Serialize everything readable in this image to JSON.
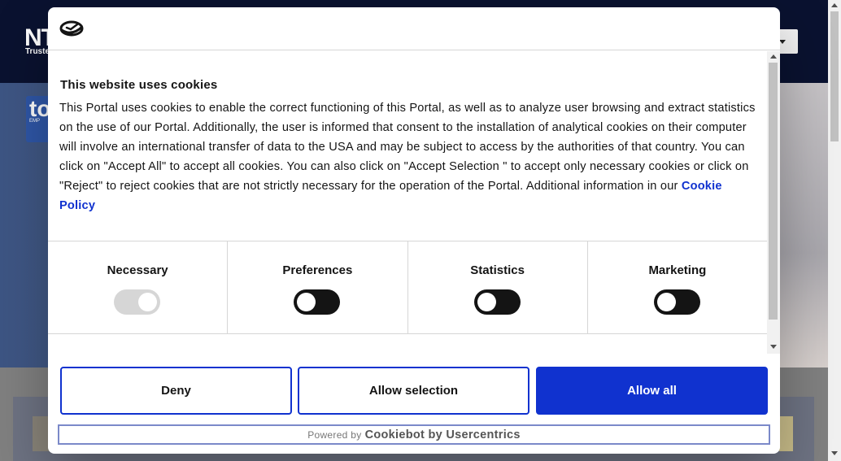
{
  "background": {
    "logo": "NT",
    "logo_sub": "Truste",
    "badge": "to",
    "badge_sub": "EMP"
  },
  "dialog": {
    "title": "This website uses cookies",
    "body_text": "This Portal uses cookies to enable the correct functioning of this Portal, as well as to analyze user browsing and extract statistics on the use of our Portal. Additionally, the user is informed that consent to the installation of analytical cookies on their computer will involve an international transfer of data to the USA and may be subject to access by the authorities of that country. You can click on \"Accept All\" to accept all cookies. You can also click on \"Accept Selection \" to accept only necessary cookies or click on \"Reject\" to reject cookies that are not strictly necessary for the operation of the Portal. Additional information in our",
    "cookie_policy_link": "Cookie Policy",
    "toggles": [
      {
        "label": "Necessary",
        "state": "on-disabled"
      },
      {
        "label": "Preferences",
        "state": "off"
      },
      {
        "label": "Statistics",
        "state": "off"
      },
      {
        "label": "Marketing",
        "state": "off"
      }
    ],
    "buttons": {
      "deny": "Deny",
      "allow_selection": "Allow selection",
      "allow_all": "Allow all"
    },
    "powered_prefix": "Powered by",
    "powered_brand": "Cookiebot by Usercentrics"
  },
  "colors": {
    "accent": "#1032cf",
    "toggle_off": "#141414",
    "toggle_disabled": "#d6d6d6"
  }
}
